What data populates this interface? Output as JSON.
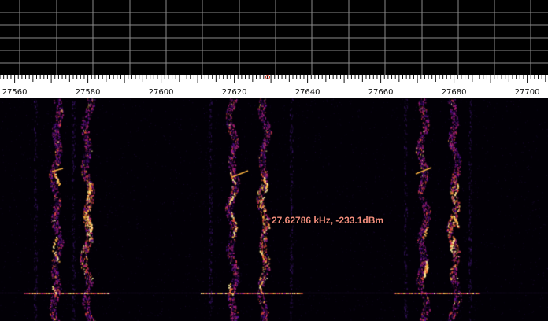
{
  "spectrum": {
    "grid_color": "#8a8a8a",
    "background": "#000000"
  },
  "scale": {
    "ticks": [
      "27560",
      "27580",
      "27600",
      "27620",
      "27640",
      "27660",
      "27680",
      "27700"
    ],
    "tick_color": "#111111",
    "cursor_marker_color": "#d0301a"
  },
  "waterfall": {
    "colormap": [
      "#1a0633",
      "#5a0f8c",
      "#b0207a",
      "#e8503a",
      "#f8b040",
      "#fff2a0"
    ],
    "signals": [
      {
        "center_khz": 27571.3,
        "label": "track"
      },
      {
        "center_khz": 27579.8,
        "label": "track"
      },
      {
        "center_khz": 27619.4,
        "label": "track"
      },
      {
        "center_khz": 27627.9,
        "label": "track"
      },
      {
        "center_khz": 27671.5,
        "label": "track"
      },
      {
        "center_khz": 27680.0,
        "label": "track"
      }
    ]
  },
  "readout": {
    "text": "27.62786 kHz, -233.1dBm",
    "color": "#f08c7c"
  }
}
